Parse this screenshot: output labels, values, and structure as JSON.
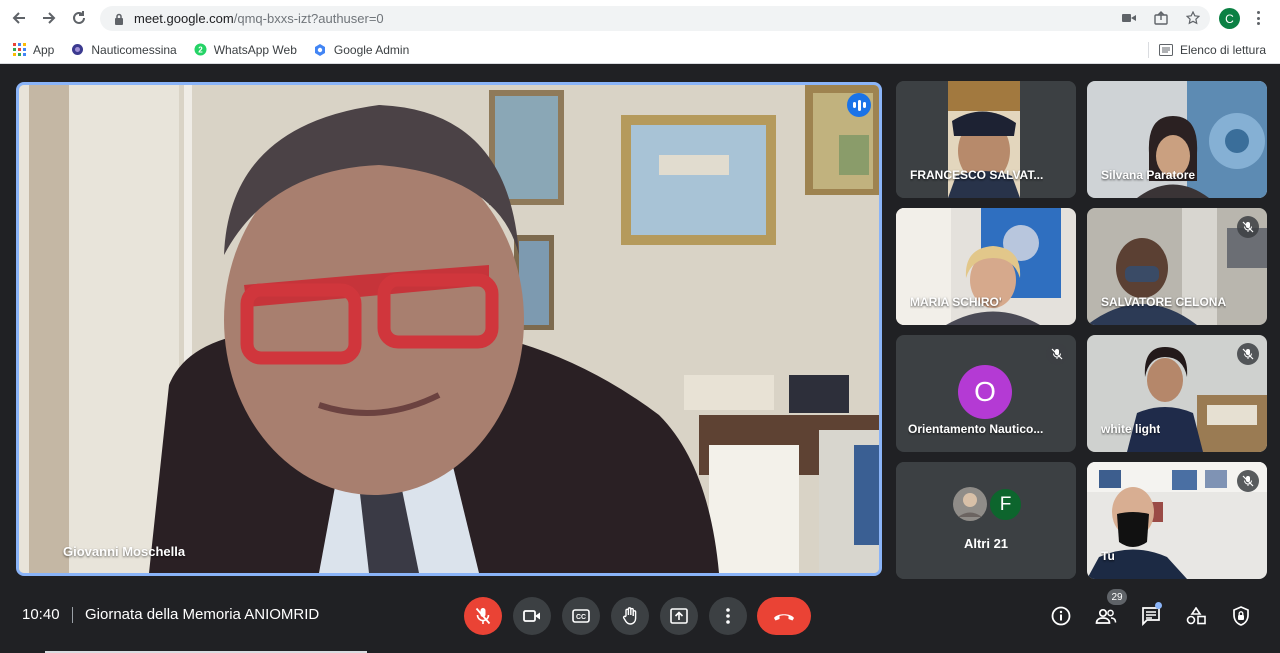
{
  "browser": {
    "url_host": "meet.google.com",
    "url_path": "/qmq-bxxs-izt?authuser=0",
    "profile_initial": "C",
    "bookmarks": [
      {
        "label": "App",
        "icon": "apps-grid-icon"
      },
      {
        "label": "Nauticomessina",
        "icon": "site-favicon-icon"
      },
      {
        "label": "WhatsApp Web",
        "icon": "whatsapp-icon"
      },
      {
        "label": "Google Admin",
        "icon": "google-admin-icon"
      }
    ],
    "reading_list": "Elenco di lettura"
  },
  "main_speaker": {
    "name": "Giovanni Moschella",
    "speaking": true
  },
  "participants": [
    {
      "name": "FRANCESCO SALVAT...",
      "muted": false
    },
    {
      "name": "Silvana Paratore",
      "muted": false
    },
    {
      "name": "MARIA SCHIRO'",
      "muted": false
    },
    {
      "name": "SALVATORE CELONA",
      "muted": true
    },
    {
      "name": "Orientamento Nautico...",
      "initial": "O",
      "muted": true
    },
    {
      "name": "white light",
      "muted": true
    },
    {
      "name": "Altri 21",
      "initial": "F"
    },
    {
      "name": "Tu",
      "muted": true
    }
  ],
  "bottom_bar": {
    "time": "10:40",
    "meeting_title": "Giornata della Memoria ANIOMRID",
    "participant_count": "29"
  },
  "colors": {
    "background": "#202124",
    "accent": "#8ab4f8",
    "danger": "#ea4335",
    "avatar_purple": "#b43ad4",
    "avatar_green": "#0d652d"
  }
}
